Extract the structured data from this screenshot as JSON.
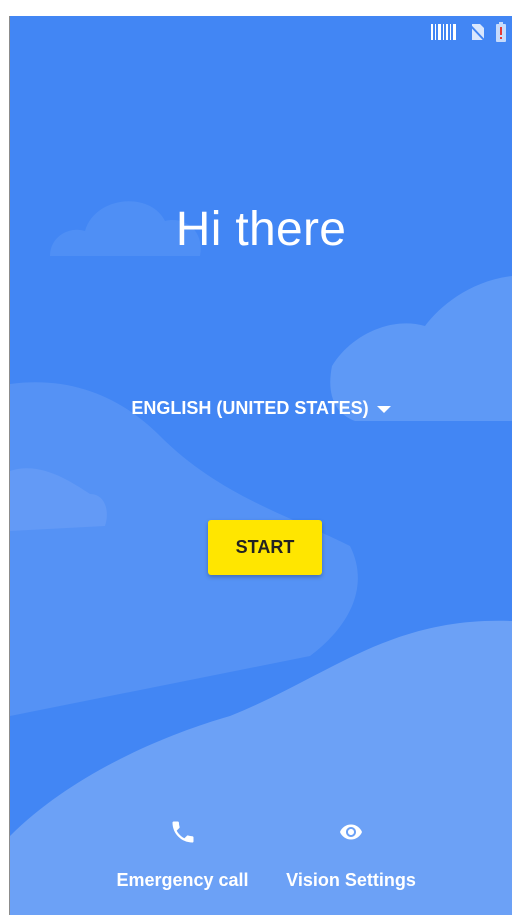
{
  "status_bar": {
    "icons": [
      "barcode-icon",
      "no-sim-icon",
      "battery-alert-icon"
    ],
    "battery_alert_color": "#e53935"
  },
  "welcome": {
    "title": "Hi there"
  },
  "language": {
    "selected": "ENGLISH (UNITED STATES)"
  },
  "start_button": {
    "label": "START",
    "color": "#ffe600"
  },
  "bottom_actions": {
    "emergency": {
      "label": "Emergency call",
      "icon": "phone-icon"
    },
    "vision": {
      "label": "Vision Settings",
      "icon": "eye-icon"
    }
  },
  "colors": {
    "background": "#4286f4",
    "cloud": "#6ca1f6"
  }
}
